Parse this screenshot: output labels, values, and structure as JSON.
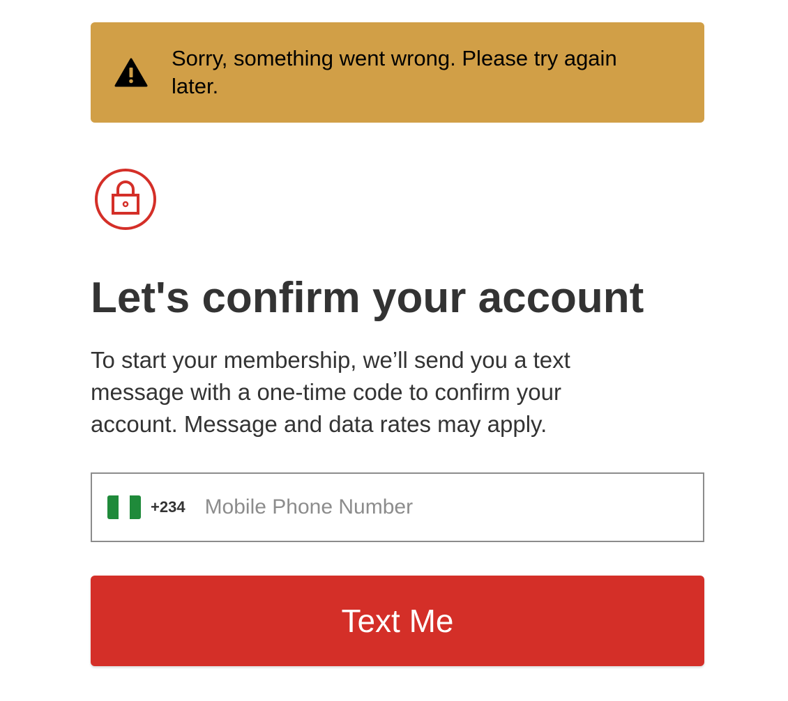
{
  "alert": {
    "icon": "warning-icon",
    "message": "Sorry, something went wrong. Please try again later.",
    "background_color": "#d19f47"
  },
  "lock": {
    "icon": "lock-icon",
    "color": "#d42f28"
  },
  "heading": "Let's confirm your account",
  "description": "To start your membership, we’ll send you a text message with a one-time code to confirm your account. Message and data rates may apply.",
  "phone": {
    "country_flag": "nigeria-flag-icon",
    "dial_code": "+234",
    "value": "",
    "placeholder": "Mobile Phone Number"
  },
  "submit": {
    "label": "Text Me",
    "color": "#d42f28"
  }
}
